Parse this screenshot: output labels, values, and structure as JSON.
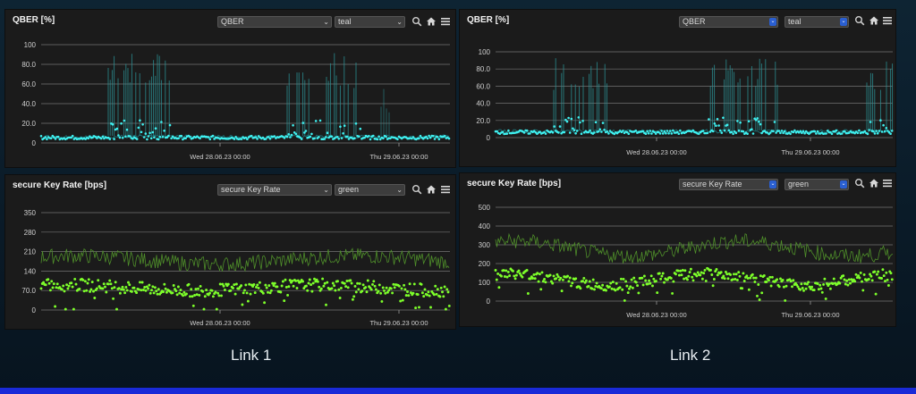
{
  "panels": [
    {
      "id": "l1-qber",
      "title": "QBER [%]",
      "selectors": [
        "QBER",
        "teal"
      ],
      "yticks": [
        "0",
        "20.0",
        "40.0",
        "60.0",
        "80.0",
        "100"
      ],
      "xticks": [
        "Wed 28.06.23 00:00",
        "Thu 29.06.23 00:00"
      ],
      "series_colors": {
        "main": "#3ff0f0",
        "spike": "#2b8f93"
      }
    },
    {
      "id": "l1-skr",
      "title": "secure Key Rate [bps]",
      "selectors": [
        "secure Key Rate",
        "green"
      ],
      "yticks": [
        "0",
        "70.0",
        "140",
        "210",
        "280",
        "350"
      ],
      "xticks": [
        "Wed 28.06.23 00:00",
        "Thu 29.06.23 00:00"
      ],
      "series_colors": {
        "main": "#7dff2a",
        "line": "#4f8f2a"
      }
    },
    {
      "id": "l2-qber",
      "title": "QBER [%]",
      "selectors": [
        "QBER",
        "teal"
      ],
      "yticks": [
        "0",
        "20.0",
        "40.0",
        "60.0",
        "80.0",
        "100"
      ],
      "xticks": [
        "Wed 28.06.23 00:00",
        "Thu 29.06.23 00:00"
      ],
      "series_colors": {
        "main": "#3ff0f0",
        "spike": "#2b8f93"
      }
    },
    {
      "id": "l2-skr",
      "title": "secure Key Rate [bps]",
      "selectors": [
        "secure Key Rate",
        "green"
      ],
      "yticks": [
        "0",
        "100",
        "200",
        "300",
        "400",
        "500"
      ],
      "xticks": [
        "Wed 28.06.23 00:00",
        "Thu 29.06.23 00:00"
      ],
      "series_colors": {
        "main": "#7dff2a",
        "line": "#4f8f2a"
      }
    }
  ],
  "labels": {
    "link1": "Link 1",
    "link2": "Link 2"
  },
  "icons": [
    "search-icon",
    "home-icon",
    "menu-icon"
  ]
}
